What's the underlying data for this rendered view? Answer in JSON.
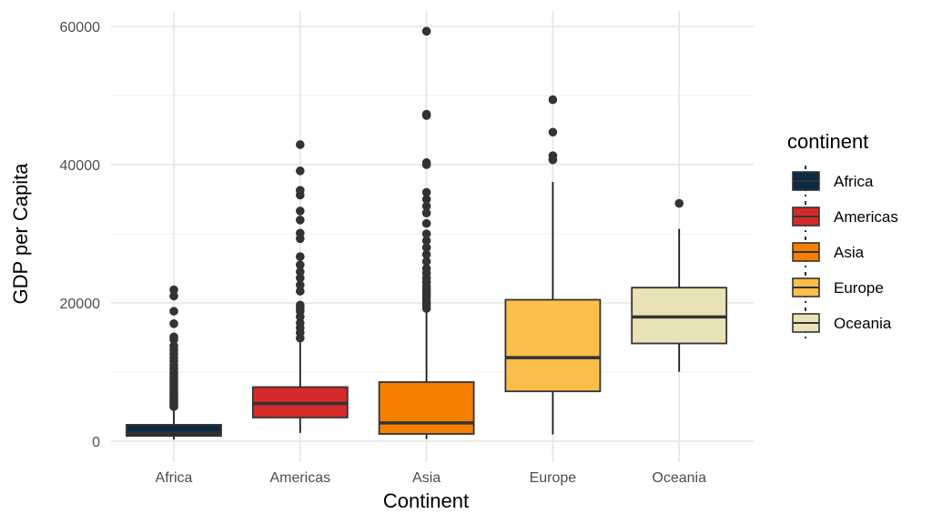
{
  "chart_data": {
    "type": "boxplot",
    "title": "",
    "xlabel": "Continent",
    "ylabel": "GDP per Capita",
    "ylim": [
      0,
      60000
    ],
    "yticks": [
      0,
      20000,
      40000,
      60000
    ],
    "ytick_labels": [
      "0",
      "20000",
      "40000",
      "60000"
    ],
    "grid": true,
    "legend": {
      "title": "continent",
      "position": "right"
    },
    "categories": [
      "Africa",
      "Americas",
      "Asia",
      "Europe",
      "Oceania"
    ],
    "series": [
      {
        "name": "Africa",
        "color": "#0b2a44",
        "min": 241,
        "q1": 761,
        "median": 1192,
        "q3": 2377,
        "max": 4800,
        "outliers": [
          5000,
          5200,
          5400,
          5600,
          5800,
          6000,
          6200,
          6500,
          6800,
          7000,
          7300,
          7600,
          7900,
          8200,
          8600,
          9000,
          9300,
          9700,
          10000,
          10500,
          11000,
          11600,
          12100,
          12600,
          13200,
          13800,
          14700,
          15100,
          17000,
          18800,
          21000,
          21900
        ]
      },
      {
        "name": "Americas",
        "color": "#d62a2a",
        "min": 1202,
        "q1": 3428,
        "median": 5466,
        "q3": 7830,
        "max": 14800,
        "outliers": [
          14900,
          15700,
          16400,
          17100,
          18000,
          18800,
          19300,
          19700,
          21700,
          22600,
          23600,
          24500,
          25500,
          26700,
          29300,
          30100,
          32000,
          33300,
          35600,
          36300,
          39100,
          42900
        ]
      },
      {
        "name": "Asia",
        "color": "#f77f00",
        "min": 331,
        "q1": 1057,
        "median": 2647,
        "q3": 8549,
        "max": 19000,
        "outliers": [
          19200,
          19600,
          20000,
          20400,
          20800,
          21200,
          21600,
          22000,
          22400,
          23000,
          23600,
          24300,
          25000,
          26000,
          27000,
          28000,
          29000,
          30000,
          31500,
          33000,
          34000,
          35000,
          36000,
          40000,
          40300,
          47100,
          47300,
          59300
        ]
      },
      {
        "name": "Europe",
        "color": "#fcbf49",
        "min": 974,
        "q1": 7213,
        "median": 12082,
        "q3": 20461,
        "max": 37500,
        "outliers": [
          40700,
          41300,
          44700,
          49400
        ]
      },
      {
        "name": "Oceania",
        "color": "#eae2b7",
        "min": 10040,
        "q1": 14142,
        "median": 17983,
        "q3": 22214,
        "max": 30700,
        "outliers": [
          34400
        ]
      }
    ]
  }
}
